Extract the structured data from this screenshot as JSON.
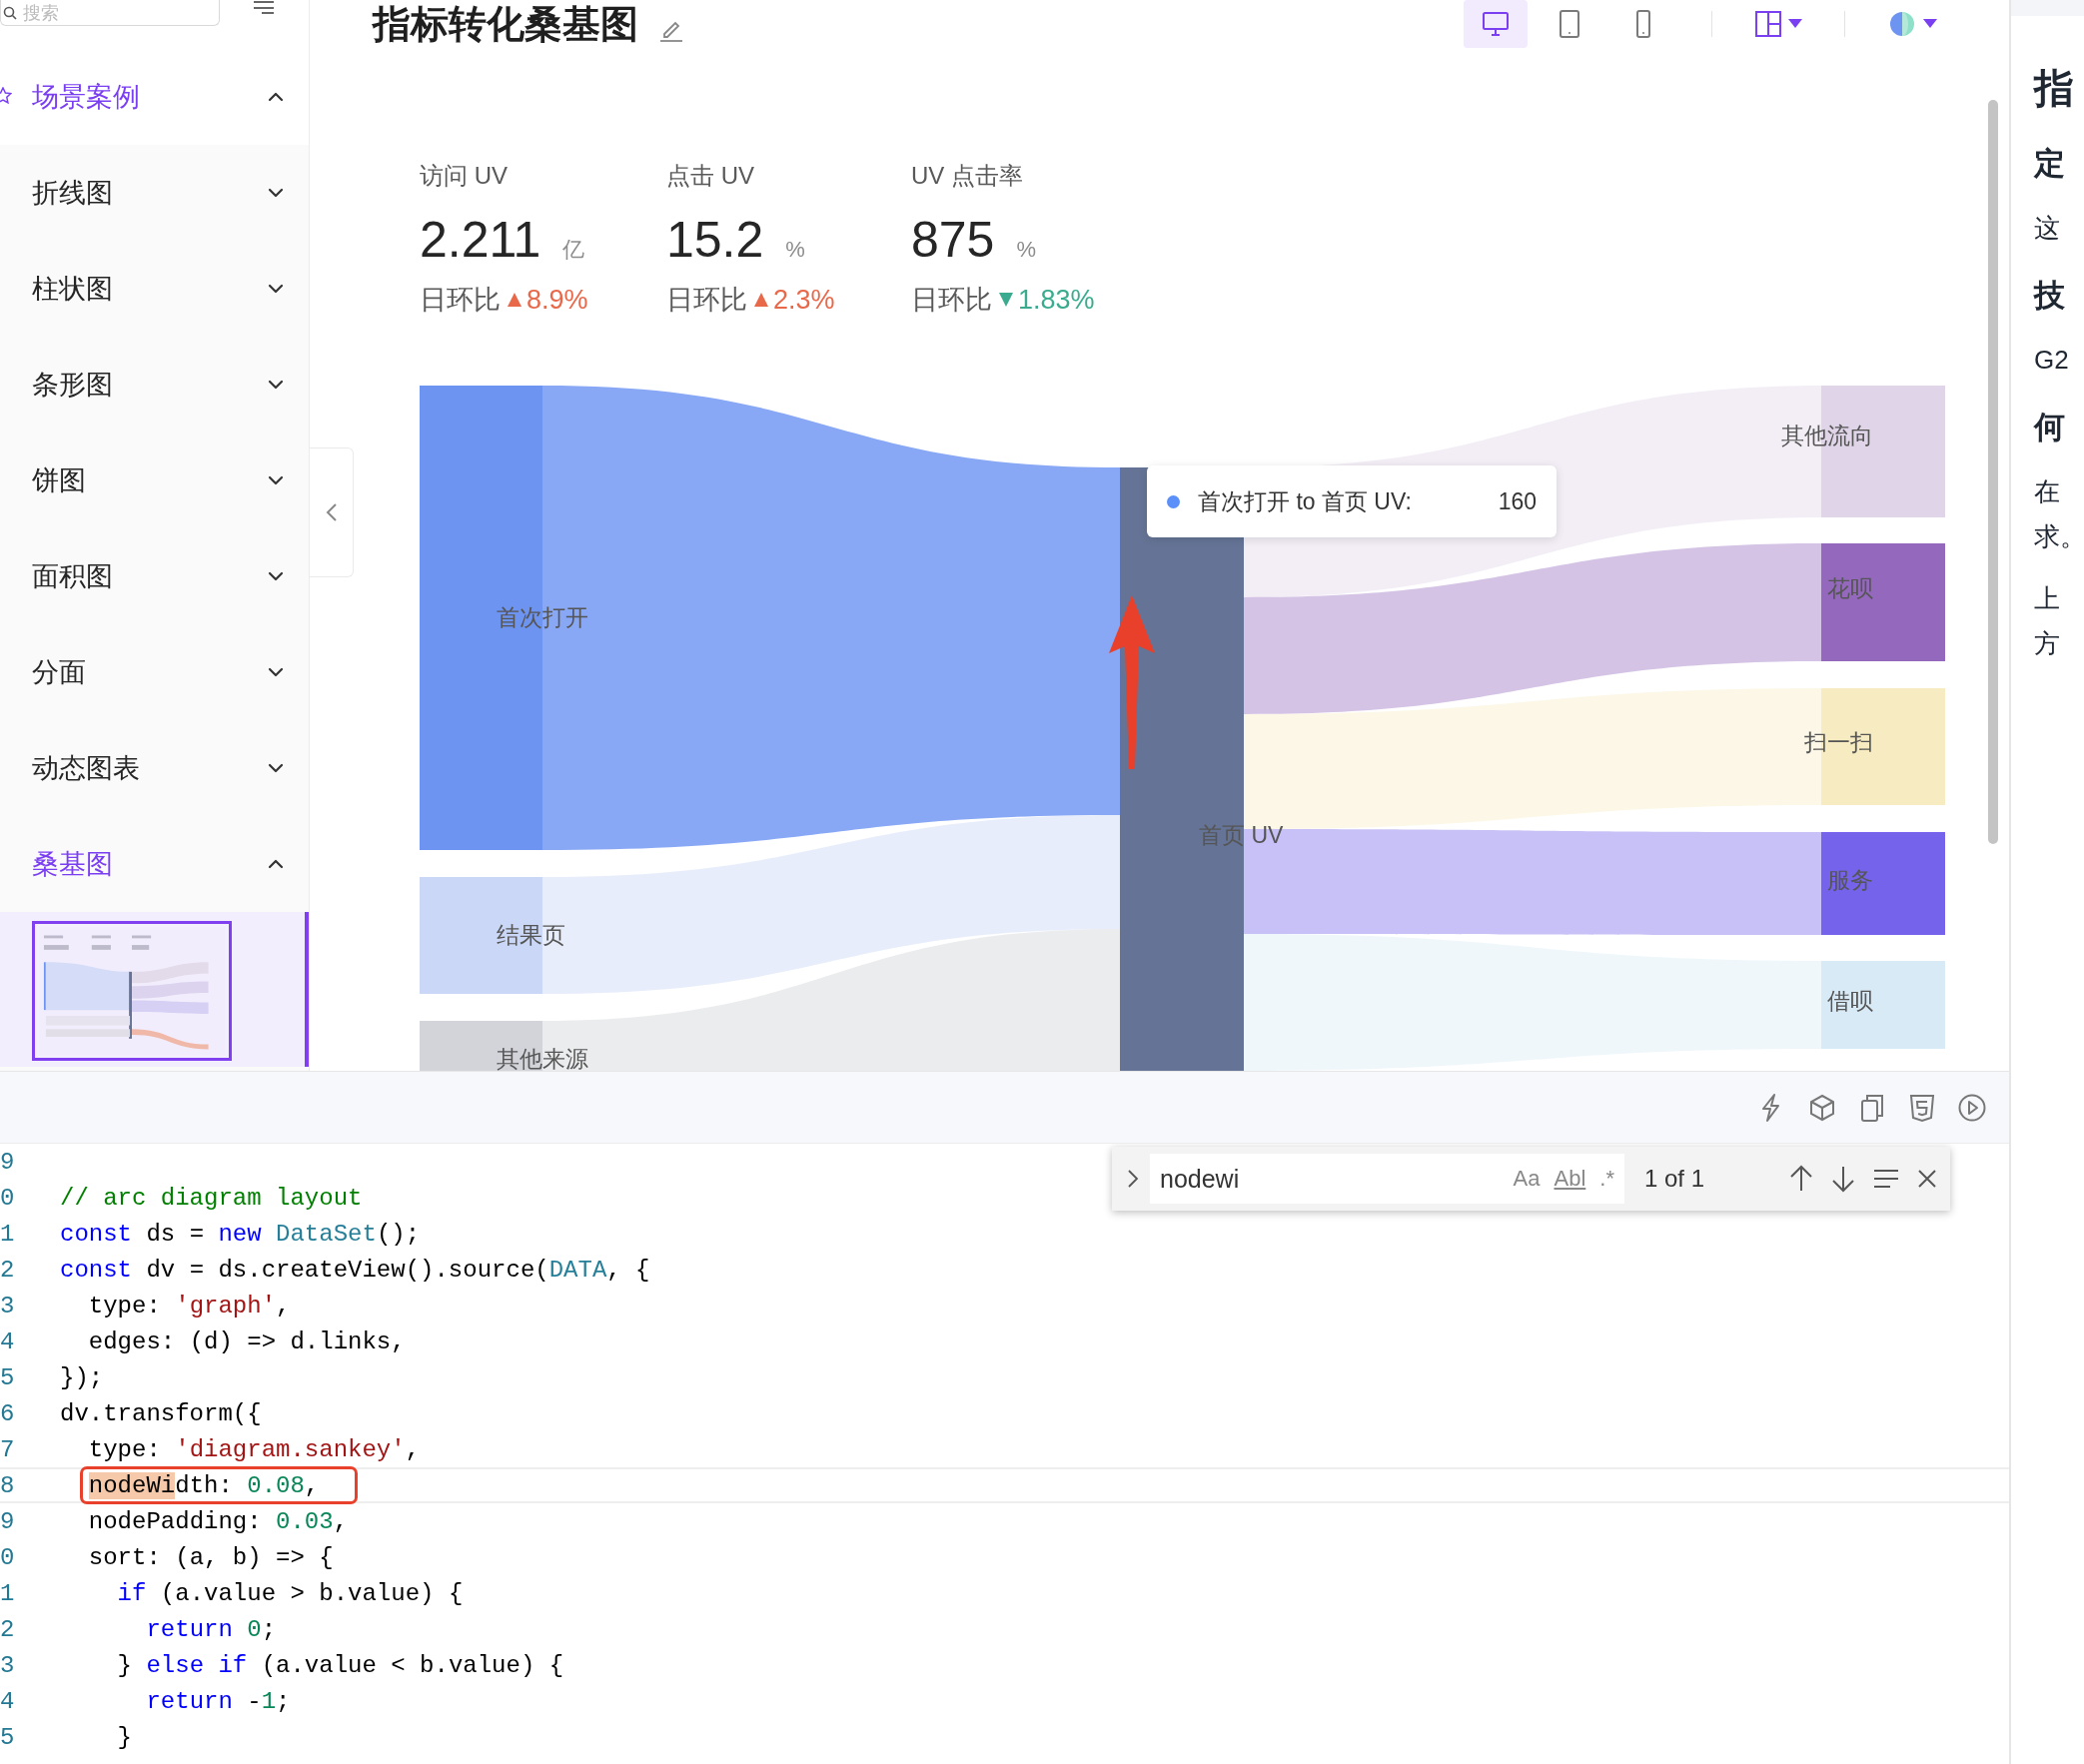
{
  "sidebar": {
    "search": {
      "placeholder": "搜索"
    },
    "items": [
      {
        "label": "场景案例",
        "kind": "group",
        "expanded": true
      },
      {
        "label": "折线图",
        "kind": "category",
        "expanded": false
      },
      {
        "label": "柱状图",
        "kind": "category",
        "expanded": false
      },
      {
        "label": "条形图",
        "kind": "category",
        "expanded": false
      },
      {
        "label": "饼图",
        "kind": "category",
        "expanded": false
      },
      {
        "label": "面积图",
        "kind": "category",
        "expanded": false
      },
      {
        "label": "分面",
        "kind": "category",
        "expanded": false
      },
      {
        "label": "动态图表",
        "kind": "category",
        "expanded": false
      },
      {
        "label": "桑基图",
        "kind": "category",
        "expanded": true
      }
    ],
    "thumbnails": [
      {
        "selected": true
      }
    ]
  },
  "header": {
    "title": "指标转化桑基图",
    "devices": [
      {
        "kind": "desktop",
        "selected": true
      },
      {
        "kind": "tablet",
        "selected": false
      },
      {
        "kind": "phone",
        "selected": false
      }
    ]
  },
  "stats": [
    {
      "label": "访问 UV",
      "value": "2.211",
      "unit": "亿",
      "change_label": "日环比",
      "kind": "up",
      "change": "8.9%"
    },
    {
      "label": "点击 UV",
      "value": "15.2",
      "unit": "%",
      "change_label": "日环比",
      "kind": "up",
      "change": "2.3%"
    },
    {
      "label": "UV 点击率",
      "value": "875",
      "unit": "%",
      "change_label": "日环比",
      "kind": "down",
      "change": "1.83%"
    }
  ],
  "sankey": {
    "sources": [
      {
        "name": "首次打开",
        "color": "#6e94f2"
      },
      {
        "name": "结果页",
        "color": "#cad7f7"
      },
      {
        "name": "其他来源",
        "color": "#d2d4da"
      }
    ],
    "hub": {
      "name": "首页 UV",
      "color": "#657496"
    },
    "targets": [
      {
        "name": "其他流向",
        "color": "#e0d4e9"
      },
      {
        "name": "花呗",
        "color": "#9468bd"
      },
      {
        "name": "扫一扫",
        "color": "#f7ecc1"
      },
      {
        "name": "服务",
        "color": "#7564eb"
      },
      {
        "name": "借呗",
        "color": "#d8eaf6"
      }
    ],
    "tooltip": {
      "label": "首次打开 to 首页 UV:",
      "value": "160",
      "color": "#5b8ff9"
    }
  },
  "editor": {
    "lines": [
      {
        "number": "9",
        "current": false,
        "annotated": false
      },
      {
        "number": "0",
        "current": false,
        "annotated": false,
        "tokens": [
          {
            "t": "// arc diagram layout",
            "kind": "comment"
          }
        ]
      },
      {
        "number": "1",
        "current": false,
        "annotated": false,
        "tokens": [
          {
            "t": "const",
            "kind": "keyword"
          },
          {
            "t": " ds = ",
            "kind": "plain"
          },
          {
            "t": "new",
            "kind": "keyword"
          },
          {
            "t": " DataSet",
            "kind": "type"
          },
          {
            "t": "();",
            "kind": "plain"
          }
        ]
      },
      {
        "number": "2",
        "current": false,
        "annotated": false,
        "tokens": [
          {
            "t": "const",
            "kind": "keyword"
          },
          {
            "t": " dv = ds.createView().source(",
            "kind": "plain"
          },
          {
            "t": "DATA",
            "kind": "type"
          },
          {
            "t": ", {",
            "kind": "plain"
          }
        ]
      },
      {
        "number": "3",
        "current": false,
        "annotated": false,
        "tokens": [
          {
            "t": "  type: ",
            "kind": "plain"
          },
          {
            "t": "'graph'",
            "kind": "string"
          },
          {
            "t": ",",
            "kind": "plain"
          }
        ]
      },
      {
        "number": "4",
        "current": false,
        "annotated": false,
        "tokens": [
          {
            "t": "  edges: (d) => d.links,",
            "kind": "plain"
          }
        ]
      },
      {
        "number": "5",
        "current": false,
        "annotated": false,
        "tokens": [
          {
            "t": "});",
            "kind": "plain"
          }
        ]
      },
      {
        "number": "6",
        "current": false,
        "annotated": false,
        "tokens": [
          {
            "t": "dv.transform({",
            "kind": "plain"
          }
        ]
      },
      {
        "number": "7",
        "current": false,
        "annotated": false,
        "tokens": [
          {
            "t": "  type: ",
            "kind": "plain"
          },
          {
            "t": "'diagram.sankey'",
            "kind": "string"
          },
          {
            "t": ",",
            "kind": "plain"
          }
        ]
      },
      {
        "number": "8",
        "current": true,
        "annotated": true,
        "tokens": [
          {
            "t": "  nodeWi",
            "kind": "match"
          },
          {
            "t": "dth: ",
            "kind": "plain"
          },
          {
            "t": "0.08",
            "kind": "number"
          },
          {
            "t": ",",
            "kind": "plain"
          }
        ]
      },
      {
        "number": "9",
        "current": false,
        "annotated": false,
        "tokens": [
          {
            "t": "  nodePadding: ",
            "kind": "plain"
          },
          {
            "t": "0.03",
            "kind": "number"
          },
          {
            "t": ",",
            "kind": "plain"
          }
        ]
      },
      {
        "number": "0",
        "current": false,
        "annotated": false,
        "tokens": [
          {
            "t": "  sort: (a, b) => {",
            "kind": "plain"
          }
        ]
      },
      {
        "number": "1",
        "current": false,
        "annotated": false,
        "tokens": [
          {
            "t": "    if",
            "kind": "keyword"
          },
          {
            "t": " (a.value > b.value) {",
            "kind": "plain"
          }
        ]
      },
      {
        "number": "2",
        "current": false,
        "annotated": false,
        "tokens": [
          {
            "t": "      return",
            "kind": "keyword"
          },
          {
            "t": " 0",
            "kind": "number"
          },
          {
            "t": ";",
            "kind": "plain"
          }
        ]
      },
      {
        "number": "3",
        "current": false,
        "annotated": false,
        "tokens": [
          {
            "t": "    } ",
            "kind": "plain"
          },
          {
            "t": "else if",
            "kind": "keyword"
          },
          {
            "t": " (a.value < b.value) {",
            "kind": "plain"
          }
        ]
      },
      {
        "number": "4",
        "current": false,
        "annotated": false,
        "tokens": [
          {
            "t": "      return",
            "kind": "keyword"
          },
          {
            "t": " -",
            "kind": "plain"
          },
          {
            "t": "1",
            "kind": "number"
          },
          {
            "t": ";",
            "kind": "plain"
          }
        ]
      },
      {
        "number": "5",
        "current": false,
        "annotated": false,
        "tokens": [
          {
            "t": "    }",
            "kind": "plain"
          }
        ]
      }
    ]
  },
  "find": {
    "query": "nodewi",
    "options": [
      "Aa",
      "Abl",
      ".*"
    ],
    "count": "1 of 1"
  },
  "doc": {
    "lines": [
      {
        "text": "指",
        "kind": "title"
      },
      {
        "text": "定",
        "kind": "heading"
      },
      {
        "text": "这",
        "kind": "text"
      },
      {
        "text": "技",
        "kind": "heading"
      },
      {
        "text": "G2",
        "kind": "text"
      },
      {
        "text": "何",
        "kind": "heading"
      },
      {
        "text": "在",
        "kind": "text"
      },
      {
        "text": "求。",
        "kind": "continuation"
      },
      {
        "text": "上",
        "kind": "text"
      },
      {
        "text": "方",
        "kind": "continuation"
      }
    ]
  }
}
